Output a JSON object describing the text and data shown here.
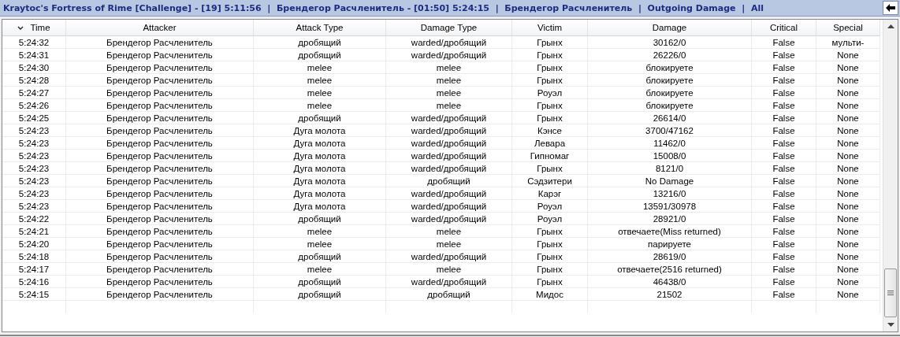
{
  "title_bar": {
    "title": "Kraytoc's Fortress of Rime [Challenge] - [19] 5:11:56  |  Брендегор Расчленитель - [01:50] 5:24:15  |  Брендегор Расчленитель  |  Outgoing Damage  |  All"
  },
  "table": {
    "columns": [
      {
        "label": "Time",
        "sorted": true
      },
      {
        "label": "Attacker",
        "sorted": false
      },
      {
        "label": "Attack Type",
        "sorted": false
      },
      {
        "label": "Damage Type",
        "sorted": false
      },
      {
        "label": "Victim",
        "sorted": false
      },
      {
        "label": "Damage",
        "sorted": false
      },
      {
        "label": "Critical",
        "sorted": false
      },
      {
        "label": "Special",
        "sorted": false
      }
    ],
    "rows": [
      [
        "5:24:32",
        "Брендегор Расчленитель",
        "дробящий",
        "warded/дробящий",
        "Грынх",
        "30162/0",
        "False",
        "мульти-"
      ],
      [
        "5:24:31",
        "Брендегор Расчленитель",
        "дробящий",
        "warded/дробящий",
        "Грынх",
        "26226/0",
        "False",
        "None"
      ],
      [
        "5:24:30",
        "Брендегор Расчленитель",
        "melee",
        "melee",
        "Грынх",
        "блокируете",
        "False",
        "None"
      ],
      [
        "5:24:28",
        "Брендегор Расчленитель",
        "melee",
        "melee",
        "Грынх",
        "блокируете",
        "False",
        "None"
      ],
      [
        "5:24:27",
        "Брендегор Расчленитель",
        "melee",
        "melee",
        "Роуэл",
        "блокируете",
        "False",
        "None"
      ],
      [
        "5:24:26",
        "Брендегор Расчленитель",
        "melee",
        "melee",
        "Грынх",
        "блокируете",
        "False",
        "None"
      ],
      [
        "5:24:25",
        "Брендегор Расчленитель",
        "дробящий",
        "warded/дробящий",
        "Грынх",
        "26614/0",
        "False",
        "None"
      ],
      [
        "5:24:23",
        "Брендегор Расчленитель",
        "Дуга молота",
        "warded/дробящий",
        "Кэнсе",
        "3700/47162",
        "False",
        "None"
      ],
      [
        "5:24:23",
        "Брендегор Расчленитель",
        "Дуга молота",
        "warded/дробящий",
        "Левара",
        "11462/0",
        "False",
        "None"
      ],
      [
        "5:24:23",
        "Брендегор Расчленитель",
        "Дуга молота",
        "warded/дробящий",
        "Гипномаг",
        "15008/0",
        "False",
        "None"
      ],
      [
        "5:24:23",
        "Брендегор Расчленитель",
        "Дуга молота",
        "warded/дробящий",
        "Грынх",
        "8121/0",
        "False",
        "None"
      ],
      [
        "5:24:23",
        "Брендегор Расчленитель",
        "Дуга молота",
        "дробящий",
        "Сэдзитери",
        "No Damage",
        "False",
        "None"
      ],
      [
        "5:24:23",
        "Брендегор Расчленитель",
        "Дуга молота",
        "warded/дробящий",
        "Карэг",
        "13216/0",
        "False",
        "None"
      ],
      [
        "5:24:23",
        "Брендегор Расчленитель",
        "Дуга молота",
        "warded/дробящий",
        "Роуэл",
        "13591/30978",
        "False",
        "None"
      ],
      [
        "5:24:22",
        "Брендегор Расчленитель",
        "дробящий",
        "warded/дробящий",
        "Роуэл",
        "28921/0",
        "False",
        "None"
      ],
      [
        "5:24:21",
        "Брендегор Расчленитель",
        "melee",
        "melee",
        "Грынх",
        "отвечаете(Miss returned)",
        "False",
        "None"
      ],
      [
        "5:24:20",
        "Брендегор Расчленитель",
        "melee",
        "melee",
        "Грынх",
        "парируете",
        "False",
        "None"
      ],
      [
        "5:24:18",
        "Брендегор Расчленитель",
        "дробящий",
        "warded/дробящий",
        "Грынх",
        "28619/0",
        "False",
        "None"
      ],
      [
        "5:24:17",
        "Брендегор Расчленитель",
        "melee",
        "melee",
        "Грынх",
        "отвечаете(2516 returned)",
        "False",
        "None"
      ],
      [
        "5:24:16",
        "Брендегор Расчленитель",
        "дробящий",
        "warded/дробящий",
        "Грынх",
        "46438/0",
        "False",
        "None"
      ],
      [
        "5:24:15",
        "Брендегор Расчленитель",
        "дробящий",
        "дробящий",
        "Мидос",
        "21502",
        "False",
        "None"
      ]
    ]
  }
}
